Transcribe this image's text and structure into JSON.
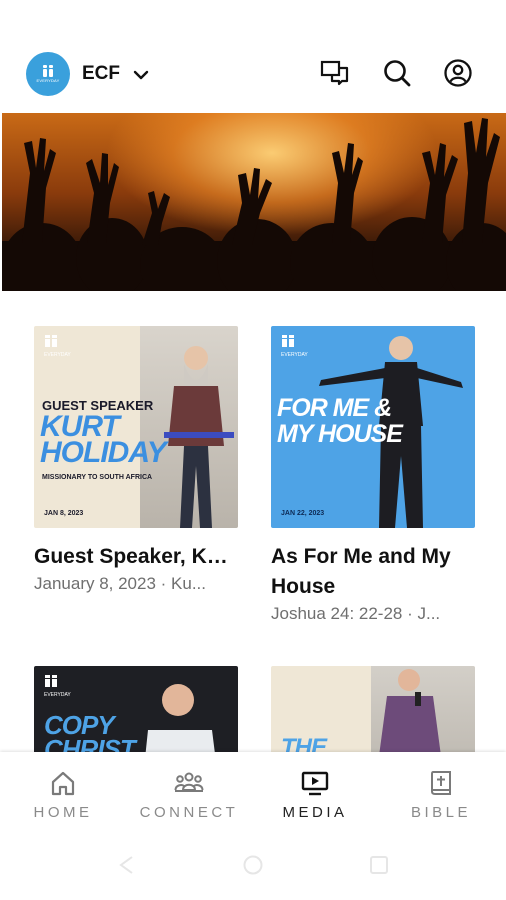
{
  "header": {
    "org_name": "ECF",
    "logo_caption": "EVERYDAY",
    "icons": [
      "chat-icon",
      "search-icon",
      "account-icon"
    ]
  },
  "banner": {
    "icon": "worship-hands-photo"
  },
  "sermons": [
    {
      "title": "Guest Speaker, Kurt Holiday. M...",
      "subtitle": "January 8, 2023 · Ku...",
      "thumb": {
        "line1": "GUEST SPEAKER",
        "line2": "KURT",
        "line3": "HOLIDAY",
        "line4": "MISSIONARY TO SOUTH AFRICA",
        "date": "JAN 8, 2023",
        "brand": "EVERYDAY"
      }
    },
    {
      "title": "As For Me and My House",
      "subtitle": "Joshua 24: 22-28 · J...",
      "thumb": {
        "line1": "FOR ME &",
        "line2": "MY HOUSE",
        "date": "JAN 22, 2023",
        "brand": "EVERYDAY"
      }
    },
    {
      "thumb": {
        "line1": "COPY",
        "line2": "CHRIST",
        "brand": "EVERYDAY"
      }
    },
    {
      "thumb": {
        "line1": "THE"
      }
    }
  ],
  "nav": {
    "items": [
      {
        "label": "HOME",
        "icon": "home-icon"
      },
      {
        "label": "CONNECT",
        "icon": "group-icon"
      },
      {
        "label": "MEDIA",
        "icon": "media-icon"
      },
      {
        "label": "BIBLE",
        "icon": "bible-icon"
      }
    ],
    "active": "MEDIA"
  },
  "colors": {
    "accent": "#3aa0dc",
    "thumb_blue": "#4ea3e6",
    "thumb_cream": "#efe7d6",
    "nav_inactive": "#8a8a8a"
  }
}
